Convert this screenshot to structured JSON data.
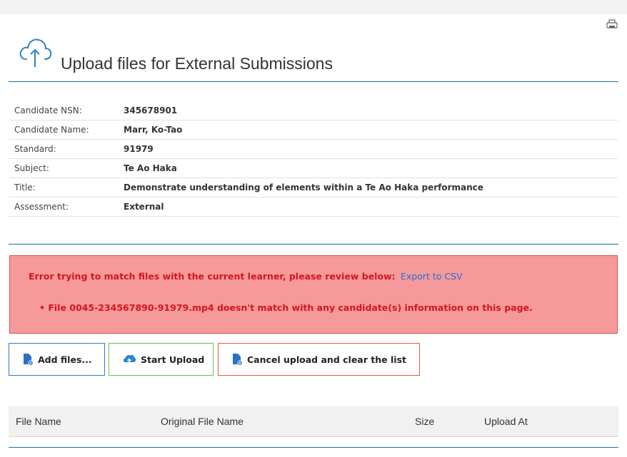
{
  "header": {
    "title": "Upload files for External Submissions",
    "cloud_icon": "cloud-upload-icon",
    "print_icon": "printer-icon"
  },
  "candidate": [
    {
      "label": "Candidate NSN:",
      "value": "345678901"
    },
    {
      "label": "Candidate Name:",
      "value": "Marr, Ko-Tao"
    },
    {
      "label": "Standard:",
      "value": "91979"
    },
    {
      "label": "Subject:",
      "value": "Te Ao Haka"
    },
    {
      "label": "Title:",
      "value": "Demonstrate understanding of elements within a Te Ao Haka performance"
    },
    {
      "label": "Assessment:",
      "value": "External"
    }
  ],
  "error": {
    "message": "Error trying to match files with the current learner, please review below:",
    "export_link": "Export to CSV",
    "items": [
      "• File 0045-234567890-91979.mp4 doesn't match with any candidate(s) information on this page."
    ]
  },
  "buttons": {
    "add": "Add files...",
    "start": "Start Upload",
    "cancel": "Cancel upload and clear the list"
  },
  "grid": {
    "columns": [
      "File Name",
      "Original File Name",
      "Size",
      "Upload At"
    ]
  },
  "colors": {
    "accent_blue": "#1f6fa3",
    "error_bg": "#f5999a",
    "error_text": "#d4161c",
    "add_border": "#2f7bc4",
    "start_border": "#6cc04a",
    "cancel_border": "#e35a3b"
  }
}
